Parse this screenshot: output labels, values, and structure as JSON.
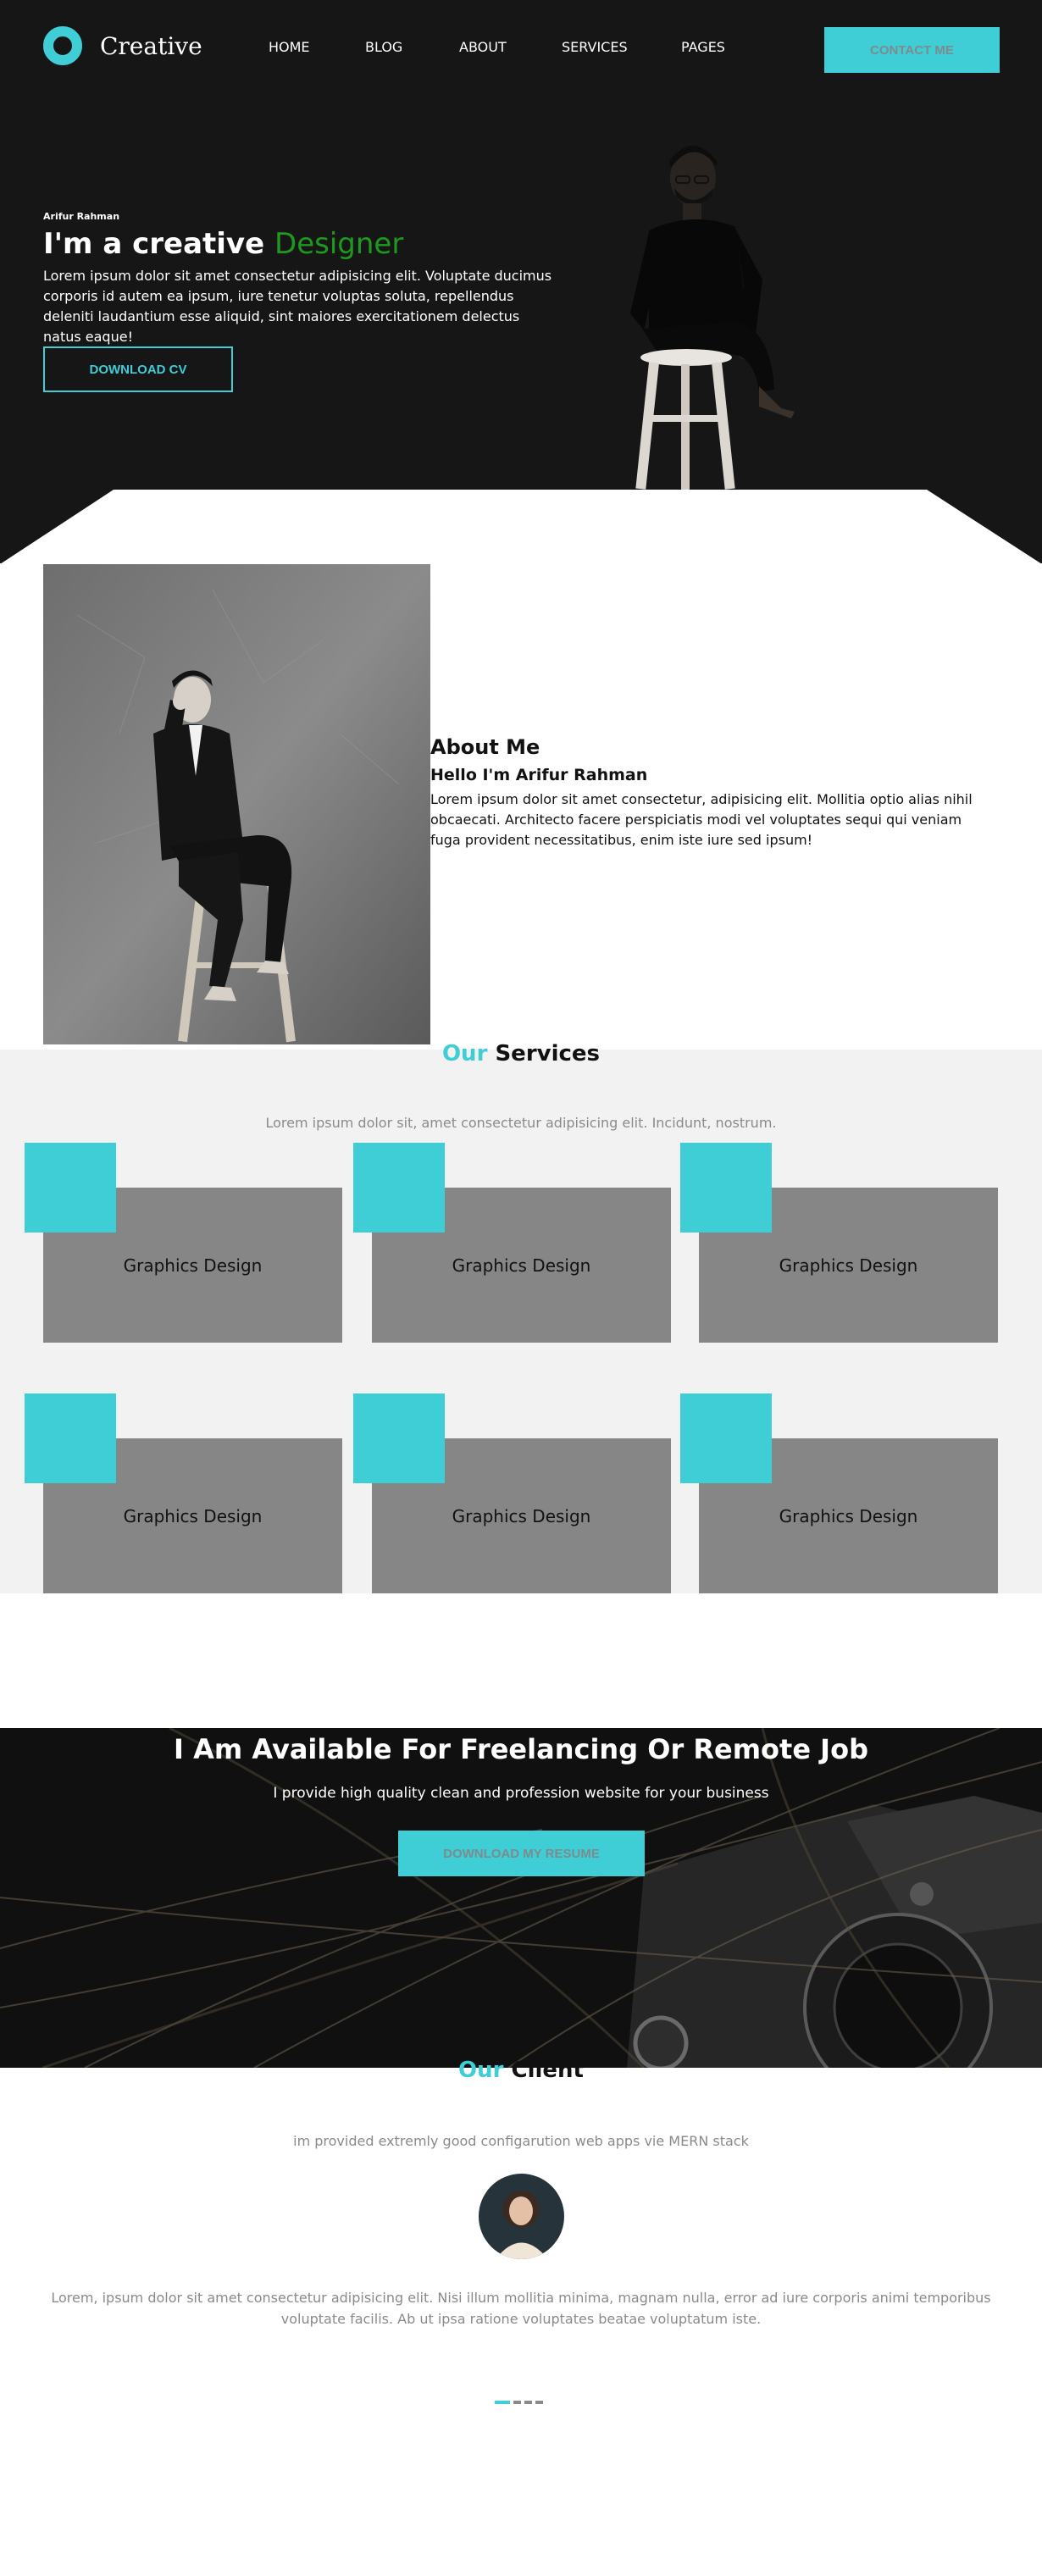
{
  "brand": {
    "name": "Creative",
    "accent_color": "#3fcdd6",
    "logo_icon": "ring-logo-icon"
  },
  "nav": {
    "items": [
      "HOME",
      "BLOG",
      "ABOUT",
      "SERVICES",
      "PAGES"
    ],
    "contact_label": "CONTACT ME"
  },
  "hero": {
    "small_name": "Arifur Rahman",
    "title_prefix": "I'm a creative",
    "title_accent": "Designer",
    "description": "Lorem ipsum dolor sit amet consectetur adipisicing elit. Voluptate ducimus corporis id autem ea ipsum, iure tenetur voluptas soluta, repellendus deleniti laudantium esse aliquid, sint maiores exercitationem delectus natus eaque!",
    "download_label": "DOWNLOAD CV"
  },
  "about": {
    "title": "About Me",
    "subtitle": "Hello I'm Arifur Rahman",
    "description": "Lorem ipsum dolor sit amet consectetur, adipisicing elit. Mollitia optio alias nihil obcaecati. Architecto facere perspiciatis modi vel voluptates sequi qui veniam fuga provident necessitatibus, enim iste iure sed ipsum!"
  },
  "services": {
    "title_accent": "Our",
    "title_rest": "Services",
    "subtitle": "Lorem ipsum dolor sit, amet consectetur adipisicing elit. Incidunt, nostrum.",
    "cards": [
      {
        "label": "Graphics Design"
      },
      {
        "label": "Graphics Design"
      },
      {
        "label": "Graphics Design"
      },
      {
        "label": "Graphics Design"
      },
      {
        "label": "Graphics Design"
      },
      {
        "label": "Graphics Design"
      }
    ]
  },
  "freelance": {
    "title": "I Am Available For Freelancing Or Remote Job",
    "subtitle": "I provide high quality clean and profession website for your business",
    "button_label": "DOWNLOAD MY RESUME"
  },
  "client": {
    "title_accent": "Our",
    "title_rest": "Client",
    "subtitle": "im provided extremly good configarution web apps vie MERN stack",
    "quote": "Lorem, ipsum dolor sit amet consectetur adipisicing elit. Nisi illum mollitia minima, magnam nulla, error ad iure corporis animi temporibus voluptate facilis. Ab ut ipsa ratione voluptates beatae voluptatum iste.",
    "slides_total": 4,
    "slide_active": 1
  }
}
